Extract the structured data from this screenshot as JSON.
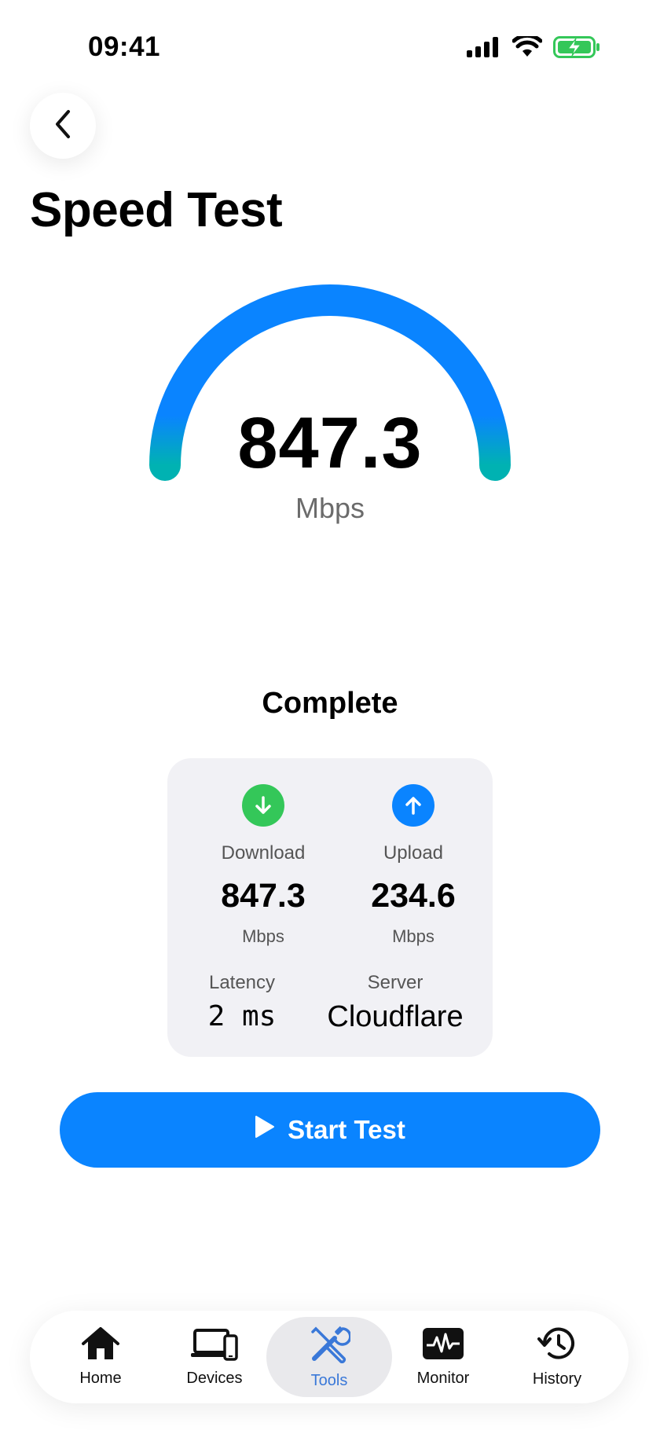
{
  "status_bar": {
    "time": "09:41",
    "icons": [
      "cellular-signal-icon",
      "wifi-icon",
      "battery-charging-icon"
    ],
    "battery_color": "#34c759"
  },
  "header": {
    "back_icon": "chevron-left-icon",
    "title": "Speed Test"
  },
  "gauge": {
    "value": "847.3",
    "unit": "Mbps",
    "progress": 1.0,
    "gradient_colors": [
      "#0a84ff",
      "#00b2b2"
    ]
  },
  "test_status": "Complete",
  "results": {
    "download": {
      "label": "Download",
      "value": "847.3",
      "unit": "Mbps",
      "icon": "arrow-down-icon",
      "color": "#34c759"
    },
    "upload": {
      "label": "Upload",
      "value": "234.6",
      "unit": "Mbps",
      "icon": "arrow-up-icon",
      "color": "#0a84ff"
    },
    "latency": {
      "label": "Latency",
      "value": "2 ms"
    },
    "server": {
      "label": "Server",
      "value": "Cloudflare"
    }
  },
  "start_button": {
    "label": "Start Test",
    "icon": "play-icon",
    "color": "#0a84ff"
  },
  "tabbar": {
    "active": "Tools",
    "active_color": "#3a78d8",
    "items": [
      {
        "label": "Home",
        "icon": "house-icon"
      },
      {
        "label": "Devices",
        "icon": "devices-icon"
      },
      {
        "label": "Tools",
        "icon": "tools-icon"
      },
      {
        "label": "Monitor",
        "icon": "waveform-monitor-icon"
      },
      {
        "label": "History",
        "icon": "history-clock-icon"
      }
    ]
  }
}
